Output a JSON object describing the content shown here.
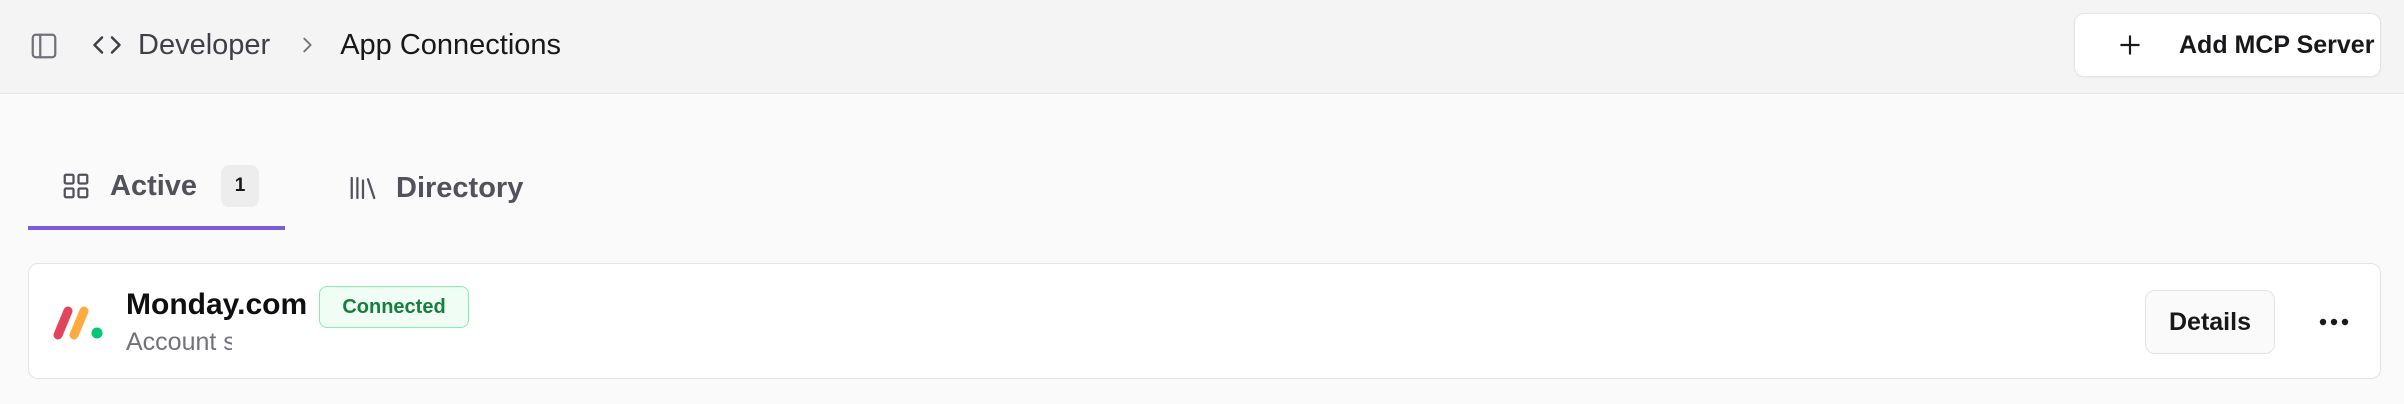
{
  "header": {
    "breadcrumb": {
      "section": "Developer",
      "current": "App Connections"
    },
    "add_button_label": "Add MCP Server"
  },
  "tabs": [
    {
      "label": "Active",
      "badge": "1",
      "icon": "grid-icon",
      "active": true
    },
    {
      "label": "Directory",
      "icon": "library-icon",
      "active": false
    }
  ],
  "accent_color": "#7c5cdb",
  "connections": [
    {
      "name": "Monday.com",
      "status": "Connected",
      "status_color": "#15803d",
      "subtitle": "Account s",
      "details_label": "Details",
      "logo_colors": [
        "#e2445c",
        "#fdab3d",
        "#00c875"
      ]
    }
  ]
}
